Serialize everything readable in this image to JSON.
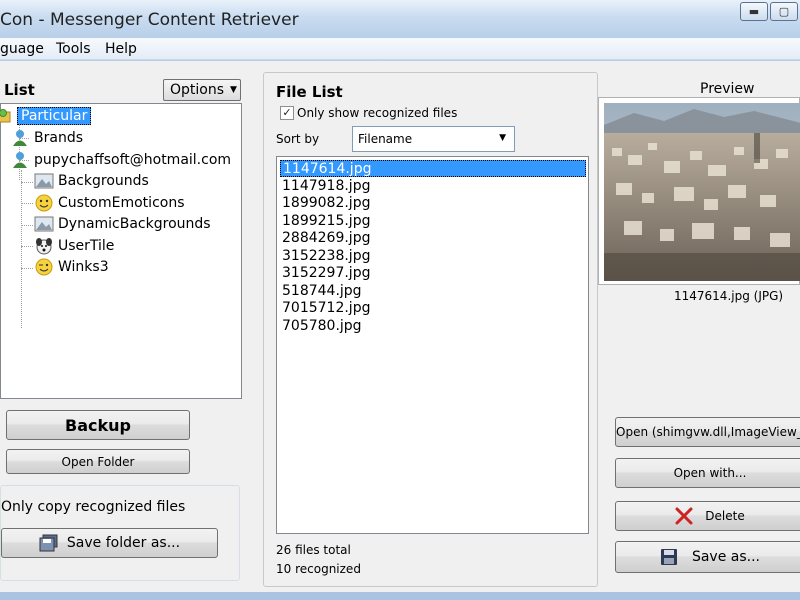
{
  "window": {
    "title": "Con - Messenger Content Retriever",
    "controls": {
      "minimize": "▬",
      "maximize": "▢",
      "close": "✕"
    }
  },
  "menu": [
    "guage",
    "Tools",
    "Help"
  ],
  "left_panel": {
    "title": "List",
    "options_label": "Options",
    "tree": [
      {
        "label": "Particular",
        "icon": "folder-user-icon",
        "selected": true
      },
      {
        "label": "Brands",
        "icon": "user-icon"
      },
      {
        "label": "pupychaffsoft@hotmail.com",
        "icon": "user-icon"
      },
      {
        "label": "Backgrounds",
        "icon": "picture-icon"
      },
      {
        "label": "CustomEmoticons",
        "icon": "smiley-icon"
      },
      {
        "label": "DynamicBackgrounds",
        "icon": "picture-icon"
      },
      {
        "label": "UserTile",
        "icon": "dog-icon"
      },
      {
        "label": "Winks3",
        "icon": "wink-icon"
      }
    ],
    "backup_label": "Backup",
    "open_folder_label": "Open Folder",
    "copy_option_label": "Only copy recognized files",
    "save_folder_label": "Save folder as..."
  },
  "middle_panel": {
    "title": "File List",
    "only_recognized_label": "Only show recognized files",
    "only_recognized_checked": true,
    "sort_label": "Sort by",
    "sort_value": "Filename",
    "files": [
      "1147614.jpg",
      "1147918.jpg",
      "1899082.jpg",
      "1899215.jpg",
      "2884269.jpg",
      "3152238.jpg",
      "3152297.jpg",
      "518744.jpg",
      "7015712.jpg",
      "705780.jpg"
    ],
    "selected_file": "1147614.jpg",
    "total_text": "26 files total",
    "recognized_text": "10 recognized"
  },
  "right_panel": {
    "preview_label": "Preview",
    "caption": "1147614.jpg (JPG)",
    "open_with_viewer_label": "Open (shimgvw.dll,ImageView_Full",
    "open_with_label": "Open with...",
    "delete_label": "Delete",
    "save_as_label": "Save as..."
  },
  "colors": {
    "selection": "#3399ff",
    "delete_icon": "#cc2222",
    "title_gradient_top": "#e9f1fa"
  }
}
